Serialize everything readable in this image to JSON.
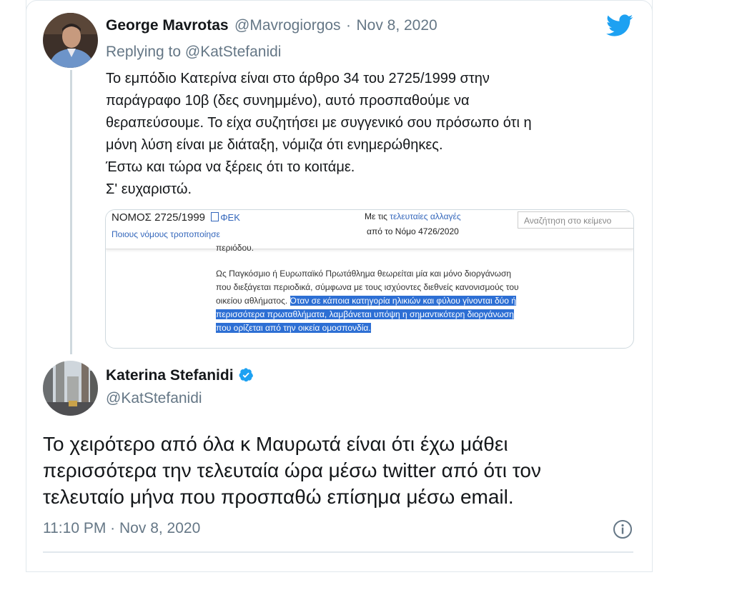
{
  "tweet1": {
    "name": "George Mavrotas",
    "handle": "@Mavrogiorgos",
    "separator": "·",
    "date": "Nov 8, 2020",
    "replying_prefix": "Replying to ",
    "replying_to": "@KatStefanidi",
    "text_lines": [
      "Το εμπόδιο Κατερίνα είναι στο άρθρο 34 του 2725/1999 στην",
      "παράγραφο 10β (δες συνημμένο), αυτό προσπαθούμε να",
      "θεραπεύσουμε. Το είχα συζητήσει με συγγενικό σου πρόσωπο ότι η",
      "μόνη λύση είναι με διάταξη, νόμιζα ότι ενημερώθηκες.",
      "Έστω και τώρα να ξέρεις ότι το κοιτάμε.",
      "Σ' ευχαριστώ."
    ],
    "attachment": {
      "law_title": "ΝΟΜΟΣ 2725/1999",
      "fek_label": "ΦΕΚ",
      "amended_link": "Ποιους νόμους τροποποίησε",
      "changes_prefix": "Με τις ",
      "changes_link": "τελευταίες αλλαγές",
      "changes_sub": "από το Νόμο 4726/2020",
      "search_placeholder": "Αναζήτηση στο κείμενο",
      "cut_line": "περιόδου.",
      "para_lines": [
        "Ως Παγκόσμιο ή Ευρωπαϊκό Πρωτάθλημα θεωρείται μία και μόνο διοργάνωση",
        "που  διεξάγεται περιοδικά, σύμφωνα με τους ισχύοντες διεθνείς κανονισμούς του",
        "οικείου αθλήματος. "
      ],
      "highlight_lines": [
        "Όταν σε κάποια κατηγορία ηλικιών και φύλου γίνονται δύο ή",
        "περισσότερα πρωταθλήματα, λαμβάνεται υπόψη η σημαντικότερη διοργάνωση",
        "που  ορίζεται από την οικεία ομοσπονδία."
      ]
    }
  },
  "tweet2": {
    "name": "Katerina Stefanidi",
    "handle": "@KatStefanidi",
    "text_lines": [
      "Το χειρότερο από όλα κ Μαυρωτά είναι ότι έχω μάθει",
      "περισσότερα την τελευταία ώρα μέσω twitter από ότι τον",
      "τελευταίο μήνα που προσπαθώ επίσημα μέσω email."
    ],
    "time": "11:10 PM",
    "separator": "·",
    "date": "Nov 8, 2020"
  },
  "colors": {
    "twitter_blue": "#1da1f2",
    "link_blue": "#1b95e0",
    "secondary_text": "#657786",
    "highlight": "#2d6fd4"
  },
  "icons": {
    "brand": "twitter-bird-icon",
    "verified": "verified-badge-icon",
    "info": "info-icon"
  }
}
